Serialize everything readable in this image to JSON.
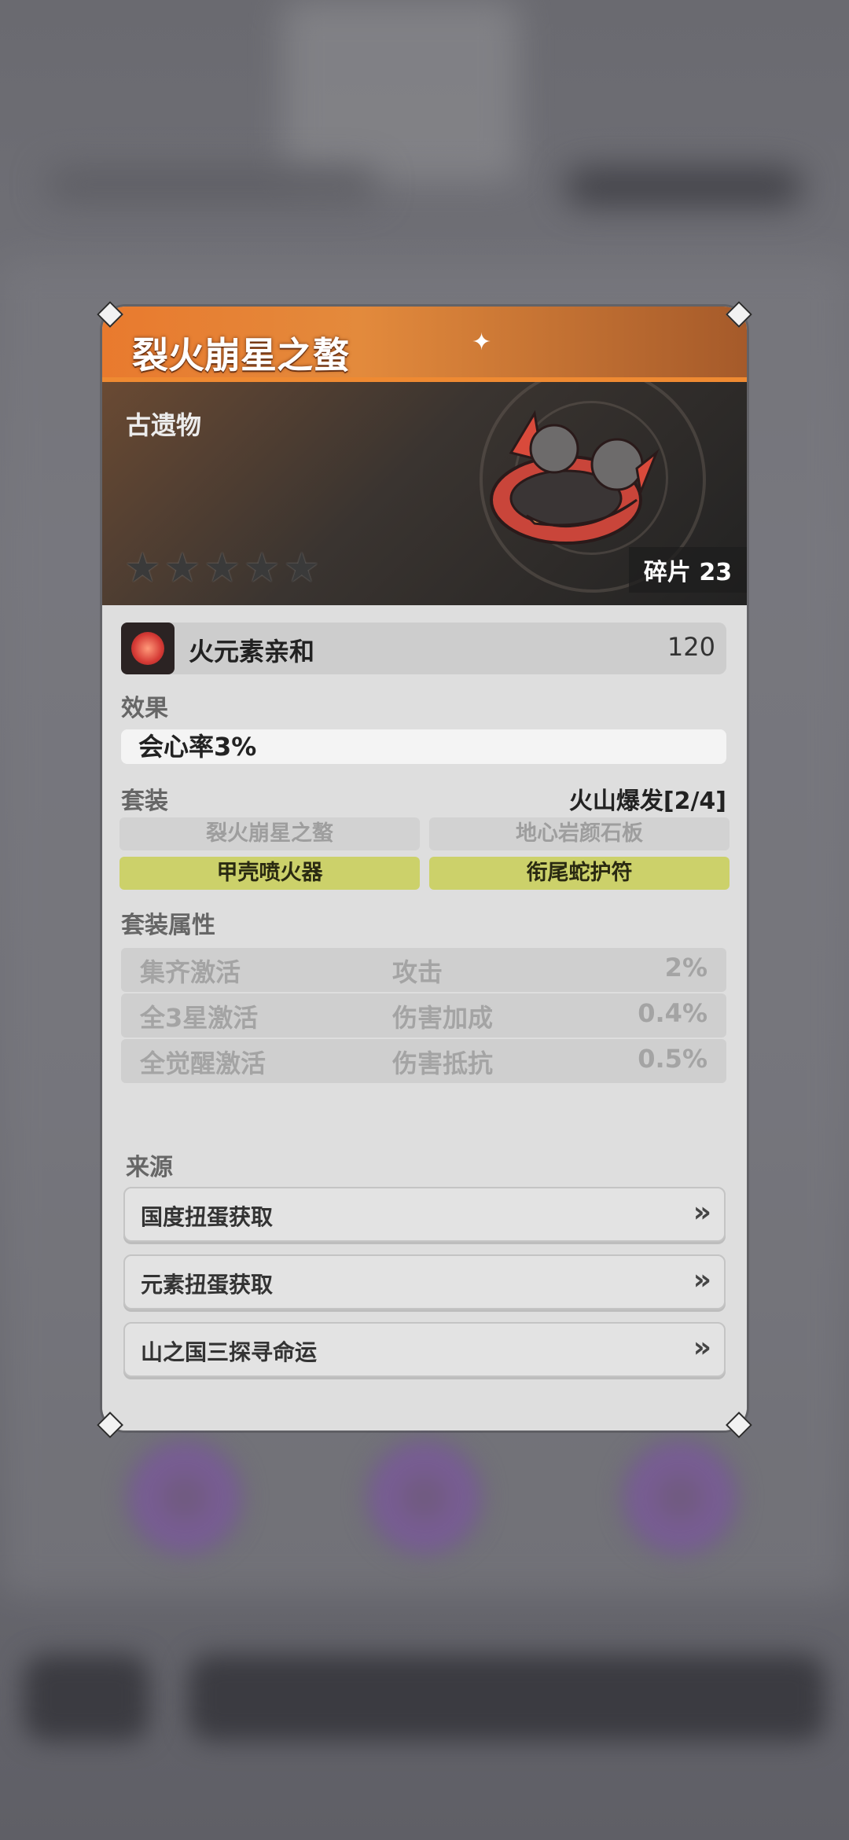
{
  "item": {
    "title": "裂火崩星之螯",
    "category": "古遗物",
    "fragments": "碎片 23",
    "stars": [
      "★",
      "★",
      "★",
      "★",
      "★"
    ]
  },
  "affinity": {
    "label": "火元素亲和",
    "value": "120",
    "icon": "fire-element-icon"
  },
  "effect": {
    "label": "效果",
    "value": "会心率3%"
  },
  "set": {
    "label": "套装",
    "name": "火山爆发[2/4]",
    "pieces": [
      {
        "name": "裂火崩星之螯",
        "owned": false
      },
      {
        "name": "地心岩颜石板",
        "owned": false
      },
      {
        "name": "甲壳喷火器",
        "owned": true
      },
      {
        "name": "衔尾蛇护符",
        "owned": true
      }
    ]
  },
  "set_attributes": {
    "label": "套装属性",
    "rows": [
      {
        "condition": "集齐激活",
        "stat": "攻击",
        "value": "2%"
      },
      {
        "condition": "全3星激活",
        "stat": "伤害加成",
        "value": "0.4%"
      },
      {
        "condition": "全觉醒激活",
        "stat": "伤害抵抗",
        "value": "0.5%"
      }
    ]
  },
  "source": {
    "label": "来源",
    "items": [
      {
        "label": "国度扭蛋获取",
        "icon": "double-chevron-right-icon"
      },
      {
        "label": "元素扭蛋获取",
        "icon": "double-chevron-right-icon"
      },
      {
        "label": "山之国三探寻命运",
        "icon": "double-chevron-right-icon"
      }
    ]
  },
  "colors": {
    "header_orange": "#e97a2e",
    "set_active": "#ccd16a",
    "card_bg": "#dcdcdc"
  }
}
